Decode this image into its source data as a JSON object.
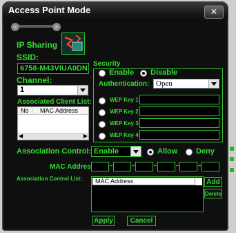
{
  "window": {
    "title": "Access Point Mode",
    "close_symbol": "✕"
  },
  "ip_sharing": {
    "label": "IP Sharing",
    "icon": "network-router-icon"
  },
  "ssid": {
    "label": "SSID:",
    "value": "6758-M43VIUA0DN"
  },
  "channel": {
    "label": "Channel:",
    "value": "1"
  },
  "assoc_clients": {
    "label": "Associated Client List:",
    "columns": [
      "No",
      "MAC Address"
    ]
  },
  "security": {
    "label": "Security",
    "enable_label": "Enable",
    "disable_label": "Disable",
    "selected": "Disable",
    "auth_label": "Authentication:",
    "auth_value": "Open",
    "wep_keys": [
      "WEP Key 1",
      "WEP Key 2",
      "WEP Key 3",
      "WEP Key 4"
    ]
  },
  "assoc_control": {
    "label": "Association Control:",
    "value": "Enable",
    "allow_label": "Allow",
    "deny_label": "Deny",
    "selected": "Allow"
  },
  "mac_address": {
    "label": "MAC Address:"
  },
  "assoc_control_list": {
    "label": "Association Control List:",
    "column": "MAC Address",
    "add_label": "Add",
    "delete_label": "Delete"
  },
  "buttons": {
    "apply": "Apply",
    "cancel": "Cancel"
  },
  "colors": {
    "accent": "#33dd33",
    "background": "#0f0f0f"
  }
}
